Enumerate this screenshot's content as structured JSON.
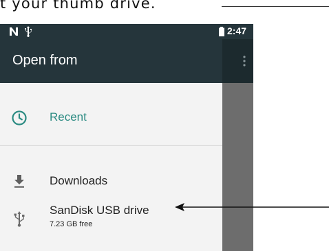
{
  "caption": {
    "text": "t your thumb drive."
  },
  "status_bar": {
    "time": "2:47",
    "icons": [
      "n-notification-icon",
      "usb-icon",
      "battery-icon"
    ]
  },
  "drawer": {
    "title": "Open from",
    "items": [
      {
        "label": "Recent",
        "icon": "clock-icon",
        "selected": true
      },
      {
        "label": "Downloads",
        "icon": "download-icon"
      },
      {
        "label": "SanDisk USB drive",
        "sublabel": "7.23 GB free",
        "icon": "usb-icon"
      }
    ]
  },
  "app_bar": {
    "overflow_icon": "more-vert-icon"
  },
  "colors": {
    "header": "#25353b",
    "drawer_bg": "#f3f3f3",
    "accent": "#2b8b82",
    "scrim": "#6d6d6d"
  }
}
